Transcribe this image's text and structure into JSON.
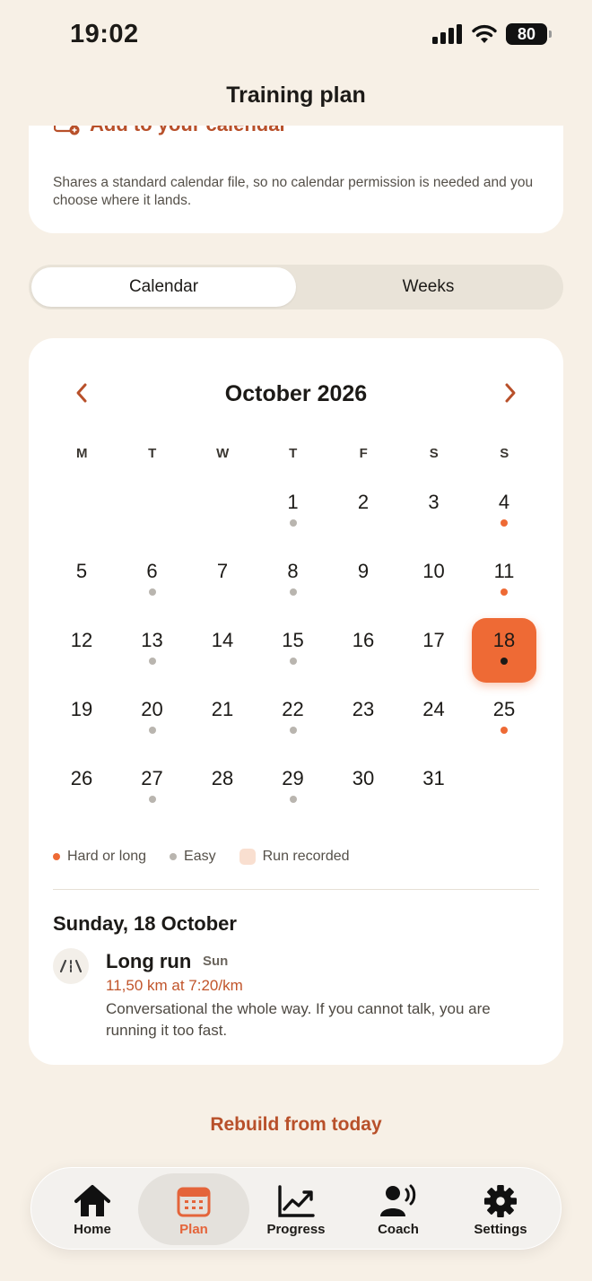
{
  "status": {
    "time": "19:02",
    "battery": "80"
  },
  "nav": {
    "title": "Training plan"
  },
  "top_card": {
    "add_calendar_label": "Add to your calendar",
    "description": "Shares a standard calendar file, so no calendar permission is needed and you choose where it lands."
  },
  "segmented": {
    "calendar": "Calendar",
    "weeks": "Weeks",
    "selected": "Calendar"
  },
  "calendar": {
    "month_title": "October 2026",
    "weekdays": [
      "M",
      "T",
      "W",
      "T",
      "F",
      "S",
      "S"
    ],
    "first_weekday_index": 3,
    "selected_day": 18,
    "days": [
      {
        "d": "1",
        "dot": "easy"
      },
      {
        "d": "2",
        "dot": ""
      },
      {
        "d": "3",
        "dot": ""
      },
      {
        "d": "4",
        "dot": "hard"
      },
      {
        "d": "5",
        "dot": ""
      },
      {
        "d": "6",
        "dot": "easy"
      },
      {
        "d": "7",
        "dot": ""
      },
      {
        "d": "8",
        "dot": "easy"
      },
      {
        "d": "9",
        "dot": ""
      },
      {
        "d": "10",
        "dot": ""
      },
      {
        "d": "11",
        "dot": "hard"
      },
      {
        "d": "12",
        "dot": ""
      },
      {
        "d": "13",
        "dot": "easy"
      },
      {
        "d": "14",
        "dot": ""
      },
      {
        "d": "15",
        "dot": "easy"
      },
      {
        "d": "16",
        "dot": ""
      },
      {
        "d": "17",
        "dot": ""
      },
      {
        "d": "18",
        "dot": "selected"
      },
      {
        "d": "19",
        "dot": ""
      },
      {
        "d": "20",
        "dot": "easy"
      },
      {
        "d": "21",
        "dot": ""
      },
      {
        "d": "22",
        "dot": "easy"
      },
      {
        "d": "23",
        "dot": ""
      },
      {
        "d": "24",
        "dot": ""
      },
      {
        "d": "25",
        "dot": "hard"
      },
      {
        "d": "26",
        "dot": ""
      },
      {
        "d": "27",
        "dot": "easy"
      },
      {
        "d": "28",
        "dot": ""
      },
      {
        "d": "29",
        "dot": "easy"
      },
      {
        "d": "30",
        "dot": ""
      },
      {
        "d": "31",
        "dot": ""
      }
    ]
  },
  "legend": {
    "hard": "Hard or long",
    "easy": "Easy",
    "recorded": "Run recorded"
  },
  "selected_detail": {
    "title": "Sunday, 18 October",
    "session_title": "Long run",
    "session_day": "Sun",
    "pace": "11,50 km at 7:20/km",
    "description": "Conversational the whole way. If you cannot talk, you are running it too fast."
  },
  "rebuild_label": "Rebuild from today",
  "tabs": {
    "home": "Home",
    "plan": "Plan",
    "progress": "Progress",
    "coach": "Coach",
    "settings": "Settings",
    "active": "Plan"
  },
  "colors": {
    "accent": "#ee6a35",
    "accent_text": "#b8502a",
    "easy_dot": "#b9b5af",
    "background": "#f7f0e6"
  }
}
